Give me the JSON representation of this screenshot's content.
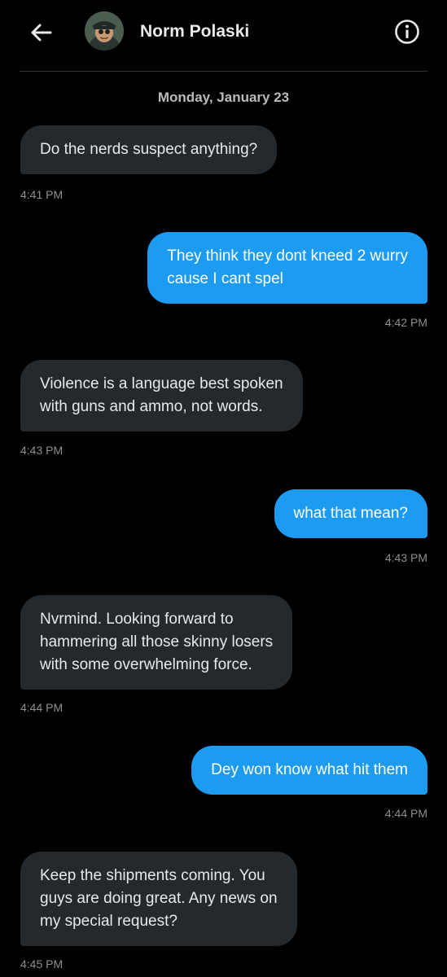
{
  "header": {
    "contact_name": "Norm Polaski",
    "back_icon": "arrow-left-icon",
    "info_icon": "info-circle-icon"
  },
  "conversation": {
    "date_separator": "Monday, January 23",
    "messages": [
      {
        "direction": "incoming",
        "text": "Do the nerds suspect anything?",
        "time": "4:41 PM"
      },
      {
        "direction": "outgoing",
        "text": "They think they dont kneed 2 wurry\ncause I cant spel",
        "time": "4:42 PM"
      },
      {
        "direction": "incoming",
        "text": "Violence is a language best spoken\nwith guns and ammo, not words.",
        "time": "4:43 PM"
      },
      {
        "direction": "outgoing",
        "text": "what that mean?",
        "time": "4:43 PM"
      },
      {
        "direction": "incoming",
        "text": "Nvrmind. Looking forward to\nhammering all those skinny losers\nwith some overwhelming force.",
        "time": "4:44 PM"
      },
      {
        "direction": "outgoing",
        "text": "Dey won know what hit them",
        "time": "4:44 PM"
      },
      {
        "direction": "incoming",
        "text": "Keep the shipments coming. You\nguys are doing great. Any news on\nmy special request?",
        "time": "4:45 PM"
      }
    ]
  },
  "colors": {
    "background": "#000000",
    "incoming_bubble": "#24292e",
    "outgoing_bubble": "#1d9bf0",
    "timestamp": "#8b8f93",
    "text": "#e7e9ea"
  }
}
